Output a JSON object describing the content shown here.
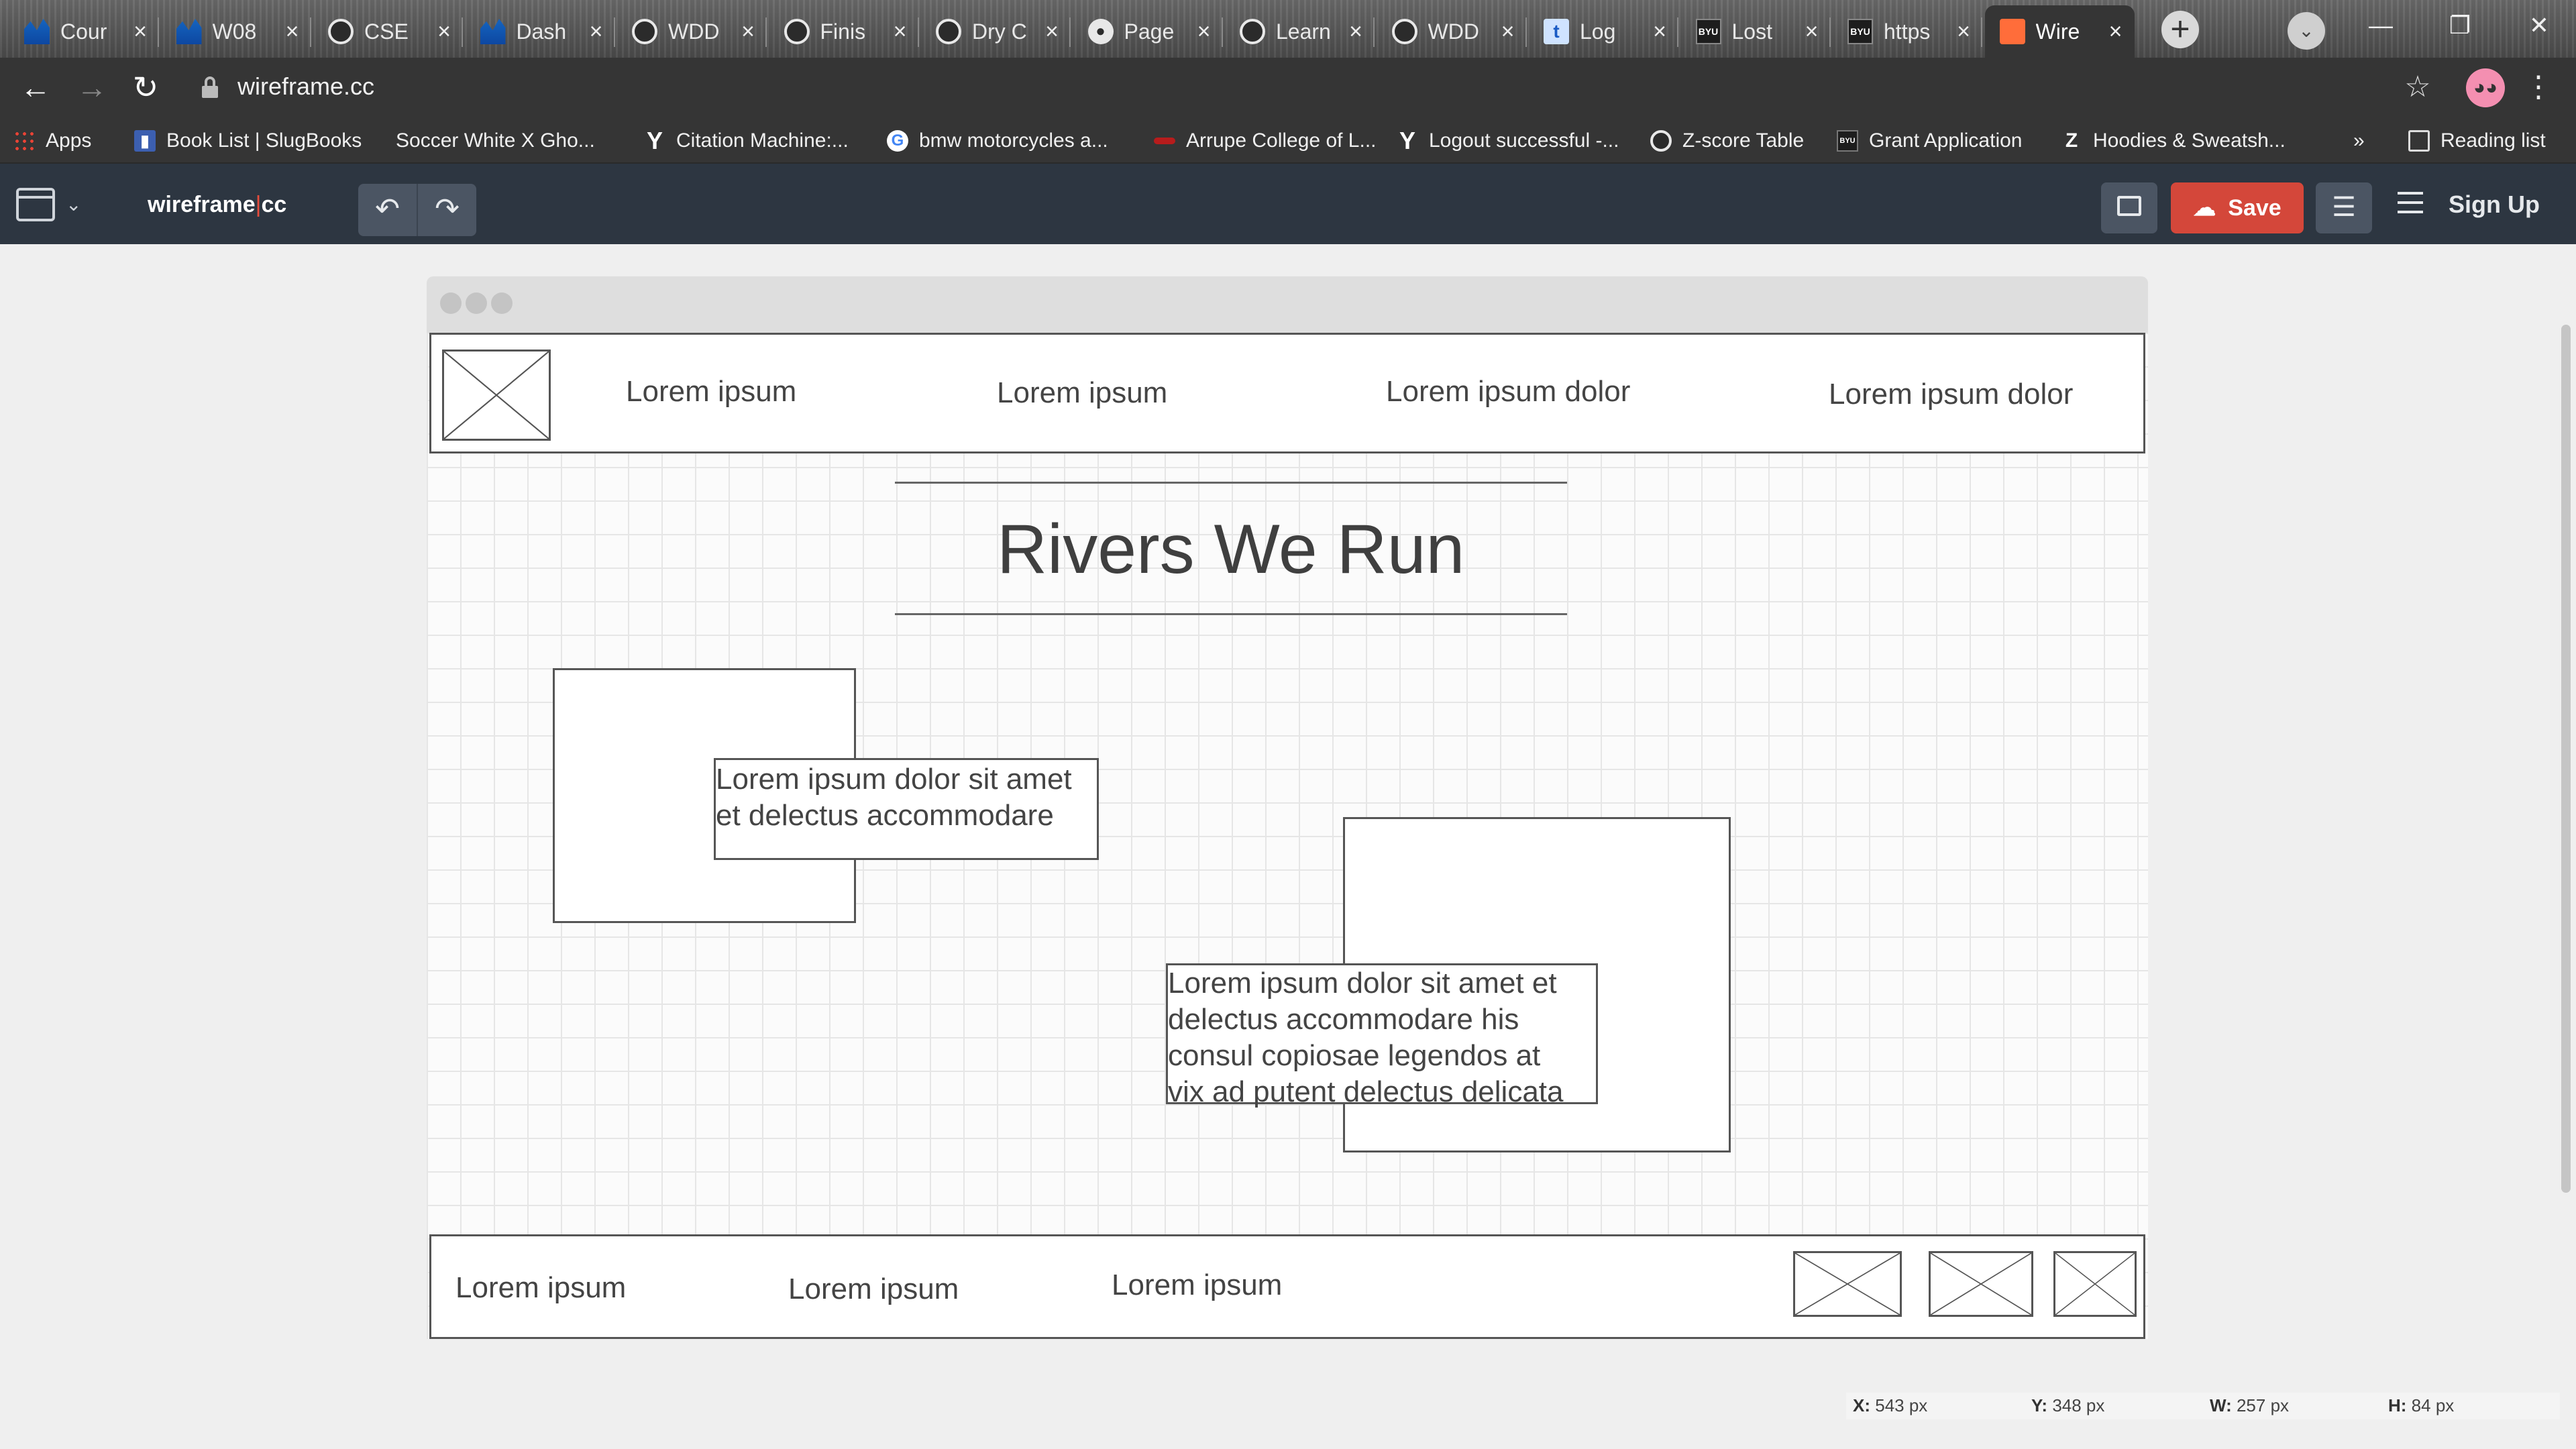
{
  "browser": {
    "tabs": [
      {
        "icon": "wave-chart-icon",
        "title": "Cour"
      },
      {
        "icon": "wave-chart-icon",
        "title": "W08"
      },
      {
        "icon": "globe-icon",
        "title": "CSE"
      },
      {
        "icon": "wave-chart-icon",
        "title": "Dash"
      },
      {
        "icon": "globe-icon",
        "title": "WDD"
      },
      {
        "icon": "globe-icon",
        "title": "Finis"
      },
      {
        "icon": "globe-icon",
        "title": "Dry C"
      },
      {
        "icon": "github-icon",
        "title": "Page"
      },
      {
        "icon": "globe-icon",
        "title": "Learn"
      },
      {
        "icon": "globe-icon",
        "title": "WDD"
      },
      {
        "icon": "t-icon",
        "title": "Log"
      },
      {
        "icon": "byu-icon",
        "title": "Lost"
      },
      {
        "icon": "byu-icon",
        "title": "https"
      },
      {
        "icon": "wireframe-icon",
        "title": "Wire"
      }
    ],
    "url": "wireframe.cc",
    "bookmarks": [
      {
        "icon": "apps-grid-icon",
        "label": "Apps"
      },
      {
        "icon": "slugbooks-icon",
        "label": "Book List | SlugBooks"
      },
      {
        "icon": "none",
        "label": "Soccer White X Gho..."
      },
      {
        "icon": "citation-icon",
        "label": "Citation Machine:..."
      },
      {
        "icon": "google-icon",
        "label": "bmw motorcycles a..."
      },
      {
        "icon": "arrupe-icon",
        "label": "Arrupe College of L..."
      },
      {
        "icon": "yahoo-icon",
        "label": "Logout successful -..."
      },
      {
        "icon": "globe-icon",
        "label": "Z-score Table"
      },
      {
        "icon": "byu-icon",
        "label": "Grant Application"
      },
      {
        "icon": "zappos-icon",
        "label": "Hoodies & Sweatsh..."
      }
    ],
    "bookmarks_overflow": "»",
    "reading_list": "Reading list"
  },
  "app": {
    "brand_left": "wireframe",
    "brand_pipe": "|",
    "brand_right": "cc",
    "undo_glyph": "↶",
    "redo_glyph": "↷",
    "save_label": "Save",
    "signup_label": "Sign Up"
  },
  "wireframe": {
    "nav": [
      "Lorem ipsum",
      "Lorem ipsum",
      "Lorem ipsum dolor",
      "Lorem ipsum dolor"
    ],
    "title": "Rivers We Run",
    "caption1": [
      "Lorem ipsum dolor sit amet",
      "et delectus accommodare"
    ],
    "caption2": [
      "Lorem ipsum dolor sit amet et",
      "delectus accommodare his",
      "consul copiosae legendos at",
      "vix ad putent delectus delicata"
    ],
    "footer": [
      "Lorem ipsum",
      "Lorem ipsum",
      "Lorem ipsum"
    ]
  },
  "status": {
    "x_label": "X:",
    "x_value": "543 px",
    "y_label": "Y:",
    "y_value": "348 px",
    "w_label": "W:",
    "w_value": "257 px",
    "h_label": "H:",
    "h_value": "84 px"
  },
  "colors": {
    "appbar": "#2d3641",
    "save_button": "#d4473a",
    "brand_pipe": "#e74c3c"
  }
}
